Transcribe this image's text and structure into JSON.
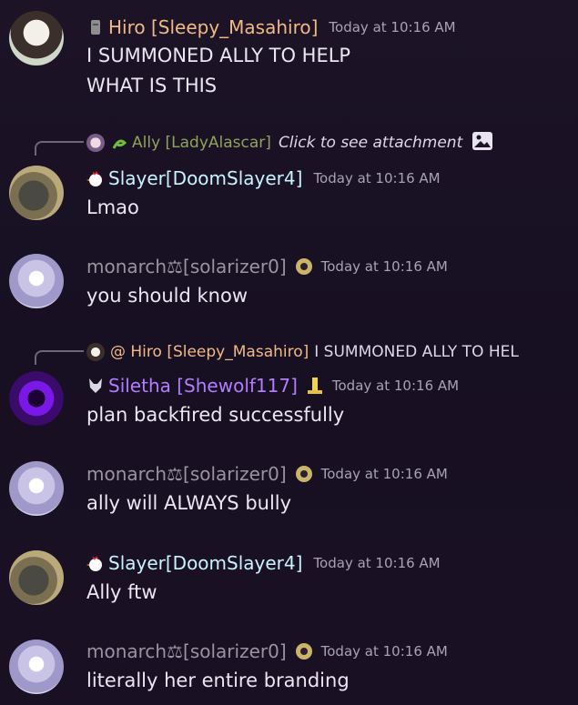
{
  "colors": {
    "hiro": "#f0b985",
    "slayer": "#c9f3ff",
    "monarch": "#99949f",
    "siletha": "#b47cff",
    "ally": "#8fa35b",
    "time": "#a7a2b4",
    "text": "#ebe7f2"
  },
  "messages": [
    {
      "author": "Hiro [Sleepy_Masahiro]",
      "timestamp": "Today at 10:16 AM",
      "lines": [
        "I SUMMONED ALLY TO HELP",
        "WHAT IS THIS"
      ]
    },
    {
      "reply_author": "Ally [LadyAlascar]",
      "reply_text": "Click to see attachment",
      "author": "Slayer[DoomSlayer4]",
      "timestamp": "Today at 10:16 AM",
      "lines": [
        "Lmao"
      ]
    },
    {
      "author": "monarch⚖[solarizer0]",
      "timestamp": "Today at 10:16 AM",
      "lines": [
        "you should know"
      ]
    },
    {
      "reply_author": "@ Hiro [Sleepy_Masahiro]",
      "reply_text": "I SUMMONED ALLY TO HEL",
      "author": "Siletha [Shewolf117]",
      "timestamp": "Today at 10:16 AM",
      "lines": [
        "plan backfired successfully"
      ]
    },
    {
      "author": "monarch⚖[solarizer0]",
      "timestamp": "Today at 10:16 AM",
      "lines": [
        "ally will ALWAYS bully"
      ]
    },
    {
      "author": "Slayer[DoomSlayer4]",
      "timestamp": "Today at 10:16 AM",
      "lines": [
        "Ally ftw"
      ]
    },
    {
      "author": "monarch⚖[solarizer0]",
      "timestamp": "Today at 10:16 AM",
      "lines": [
        "literally her entire branding"
      ]
    }
  ]
}
